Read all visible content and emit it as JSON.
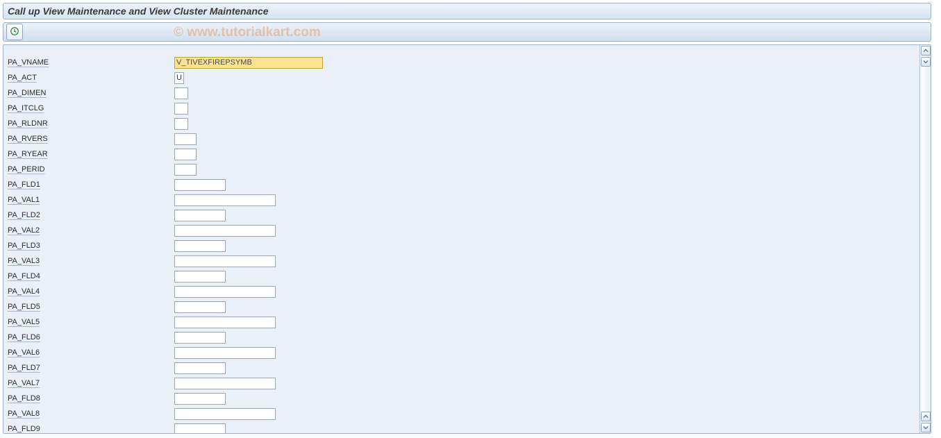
{
  "header": {
    "title": "Call up View Maintenance and View Cluster Maintenance"
  },
  "watermark": "© www.tutorialkart.com",
  "form": {
    "rows": [
      {
        "name": "pa-vname",
        "label": "PA_VNAME",
        "value": "V_TIVEXFIREPSYMB",
        "width": "w-xxl",
        "selected": true
      },
      {
        "name": "pa-act",
        "label": "PA_ACT",
        "value": "U",
        "width": "w-xs"
      },
      {
        "name": "pa-dimen",
        "label": "PA_DIMEN",
        "value": "",
        "width": "w-s"
      },
      {
        "name": "pa-itclg",
        "label": "PA_ITCLG",
        "value": "",
        "width": "w-s"
      },
      {
        "name": "pa-rldnr",
        "label": "PA_RLDNR",
        "value": "",
        "width": "w-s"
      },
      {
        "name": "pa-rvers",
        "label": "PA_RVERS",
        "value": "",
        "width": "w-sm"
      },
      {
        "name": "pa-ryear",
        "label": "PA_RYEAR",
        "value": "",
        "width": "w-sm"
      },
      {
        "name": "pa-perid",
        "label": "PA_PERID",
        "value": "",
        "width": "w-sm"
      },
      {
        "name": "pa-fld1",
        "label": "PA_FLD1",
        "value": "",
        "width": "w-m"
      },
      {
        "name": "pa-val1",
        "label": "PA_VAL1",
        "value": "",
        "width": "w-l"
      },
      {
        "name": "pa-fld2",
        "label": "PA_FLD2",
        "value": "",
        "width": "w-m"
      },
      {
        "name": "pa-val2",
        "label": "PA_VAL2",
        "value": "",
        "width": "w-l"
      },
      {
        "name": "pa-fld3",
        "label": "PA_FLD3",
        "value": "",
        "width": "w-m"
      },
      {
        "name": "pa-val3",
        "label": "PA_VAL3",
        "value": "",
        "width": "w-l"
      },
      {
        "name": "pa-fld4",
        "label": "PA_FLD4",
        "value": "",
        "width": "w-m"
      },
      {
        "name": "pa-val4",
        "label": "PA_VAL4",
        "value": "",
        "width": "w-l"
      },
      {
        "name": "pa-fld5",
        "label": "PA_FLD5",
        "value": "",
        "width": "w-m"
      },
      {
        "name": "pa-val5",
        "label": "PA_VAL5",
        "value": "",
        "width": "w-l"
      },
      {
        "name": "pa-fld6",
        "label": "PA_FLD6",
        "value": "",
        "width": "w-m"
      },
      {
        "name": "pa-val6",
        "label": "PA_VAL6",
        "value": "",
        "width": "w-l"
      },
      {
        "name": "pa-fld7",
        "label": "PA_FLD7",
        "value": "",
        "width": "w-m"
      },
      {
        "name": "pa-val7",
        "label": "PA_VAL7",
        "value": "",
        "width": "w-l"
      },
      {
        "name": "pa-fld8",
        "label": "PA_FLD8",
        "value": "",
        "width": "w-m"
      },
      {
        "name": "pa-val8",
        "label": "PA_VAL8",
        "value": "",
        "width": "w-l"
      },
      {
        "name": "pa-fld9",
        "label": "PA_FLD9",
        "value": "",
        "width": "w-m"
      }
    ]
  }
}
